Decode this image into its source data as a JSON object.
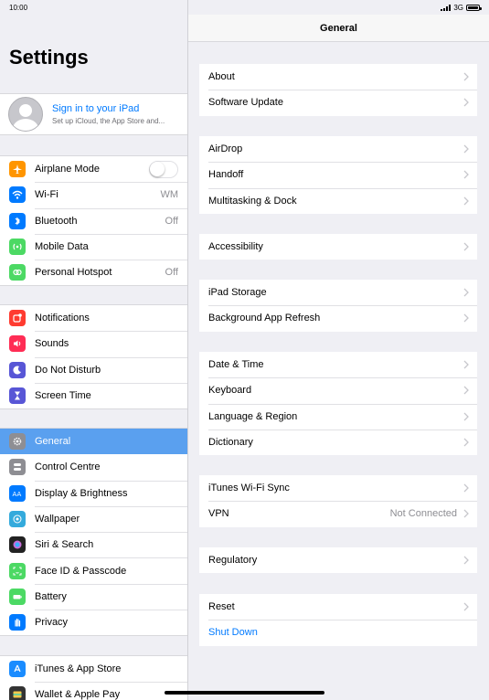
{
  "status": {
    "time": "10:00",
    "network": "3G"
  },
  "sidebar": {
    "title": "Settings",
    "profile": {
      "signin": "Sign in to your iPad",
      "subtitle": "Set up iCloud, the App Store and..."
    },
    "group1": [
      {
        "label": "Airplane Mode",
        "icon": "airplane-icon",
        "color": "#ff9500",
        "toggle": false
      },
      {
        "label": "Wi-Fi",
        "value": "WM",
        "icon": "wifi-icon",
        "color": "#007aff"
      },
      {
        "label": "Bluetooth",
        "value": "Off",
        "icon": "bluetooth-icon",
        "color": "#007aff"
      },
      {
        "label": "Mobile Data",
        "icon": "antenna-icon",
        "color": "#4cd964"
      },
      {
        "label": "Personal Hotspot",
        "value": "Off",
        "icon": "hotspot-icon",
        "color": "#4cd964"
      }
    ],
    "group2": [
      {
        "label": "Notifications",
        "icon": "notifications-icon",
        "color": "#ff3b30"
      },
      {
        "label": "Sounds",
        "icon": "speaker-icon",
        "color": "#ff2d55"
      },
      {
        "label": "Do Not Disturb",
        "icon": "moon-icon",
        "color": "#5856d6"
      },
      {
        "label": "Screen Time",
        "icon": "hourglass-icon",
        "color": "#5856d6"
      }
    ],
    "group3": [
      {
        "label": "General",
        "icon": "gear-icon",
        "color": "#8e8e93",
        "selected": true
      },
      {
        "label": "Control Centre",
        "icon": "switches-icon",
        "color": "#8e8e93"
      },
      {
        "label": "Display & Brightness",
        "icon": "text-size-icon",
        "color": "#007aff"
      },
      {
        "label": "Wallpaper",
        "icon": "flower-icon",
        "color": "#34aadc"
      },
      {
        "label": "Siri & Search",
        "icon": "siri-icon",
        "color": "#222222"
      },
      {
        "label": "Face ID & Passcode",
        "icon": "face-id-icon",
        "color": "#4cd964"
      },
      {
        "label": "Battery",
        "icon": "battery-icon",
        "color": "#4cd964"
      },
      {
        "label": "Privacy",
        "icon": "hand-icon",
        "color": "#007aff"
      }
    ],
    "group4": [
      {
        "label": "iTunes & App Store",
        "icon": "app-store-icon",
        "color": "#1a8cff"
      },
      {
        "label": "Wallet & Apple Pay",
        "icon": "wallet-icon",
        "color": "#333333"
      }
    ]
  },
  "detail": {
    "title": "General",
    "groups": [
      [
        {
          "label": "About"
        },
        {
          "label": "Software Update"
        }
      ],
      [
        {
          "label": "AirDrop"
        },
        {
          "label": "Handoff"
        },
        {
          "label": "Multitasking & Dock"
        }
      ],
      [
        {
          "label": "Accessibility"
        }
      ],
      [
        {
          "label": "iPad Storage"
        },
        {
          "label": "Background App Refresh"
        }
      ],
      [
        {
          "label": "Date & Time"
        },
        {
          "label": "Keyboard"
        },
        {
          "label": "Language & Region"
        },
        {
          "label": "Dictionary"
        }
      ],
      [
        {
          "label": "iTunes Wi-Fi Sync"
        },
        {
          "label": "VPN",
          "value": "Not Connected"
        }
      ],
      [
        {
          "label": "Regulatory"
        }
      ],
      [
        {
          "label": "Reset"
        },
        {
          "label": "Shut Down",
          "action": true
        }
      ]
    ]
  }
}
